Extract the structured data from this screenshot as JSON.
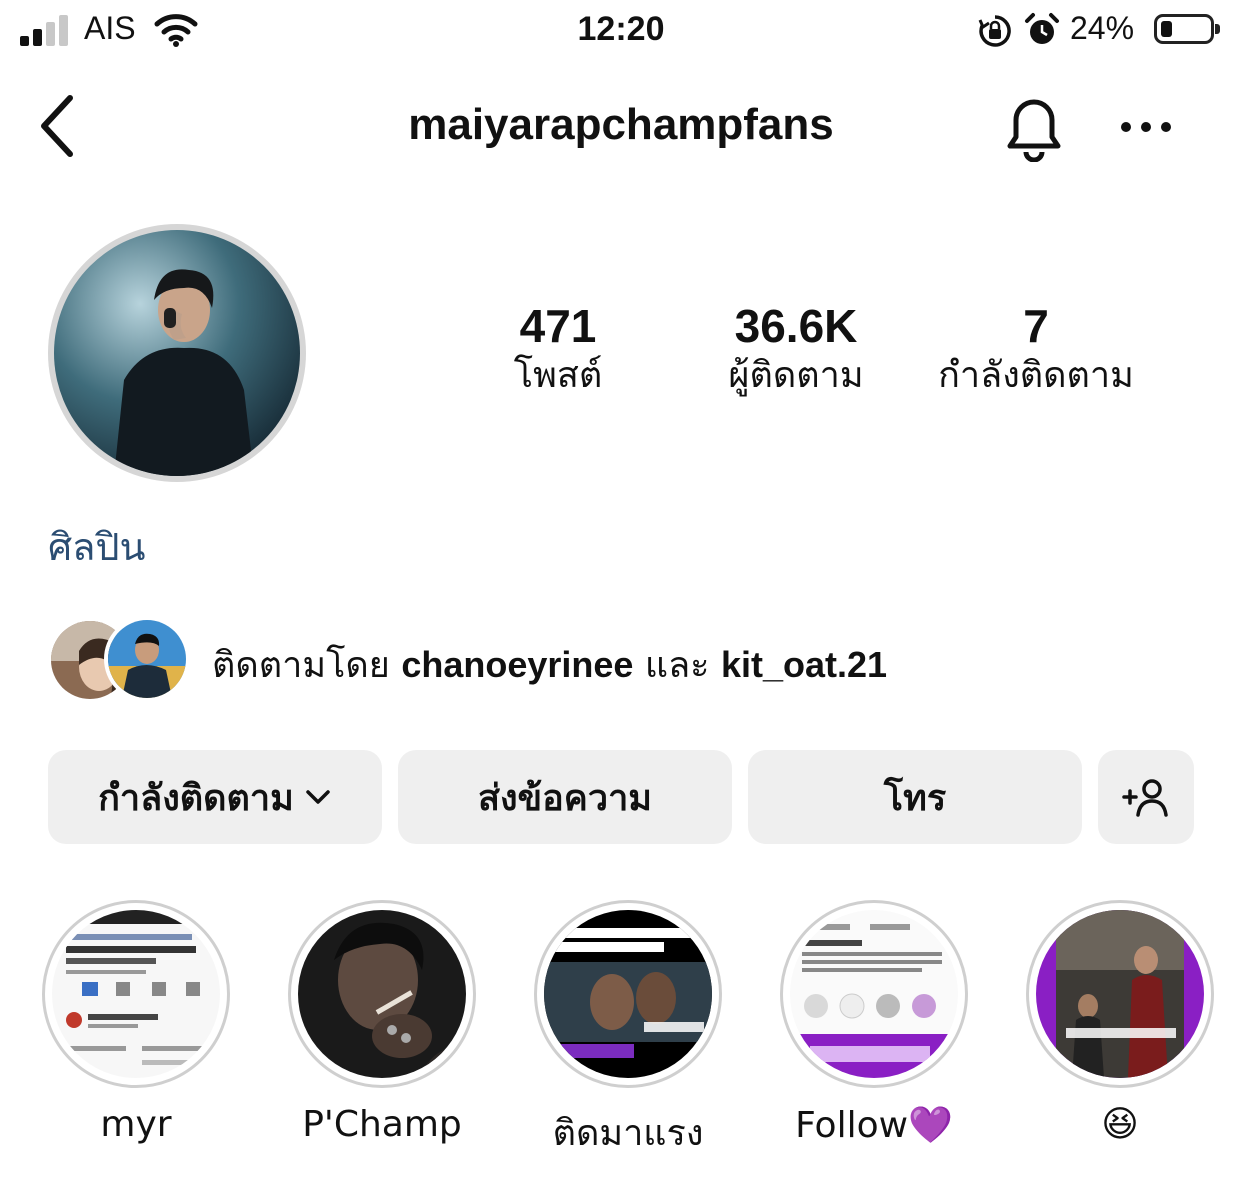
{
  "status_bar": {
    "carrier": "AIS",
    "time": "12:20",
    "battery_percent": "24%",
    "battery_level": 0.24,
    "signal_bars": 2,
    "icons": [
      "signal-icon",
      "wifi-icon",
      "rotation-lock-icon",
      "alarm-icon",
      "battery-icon"
    ]
  },
  "header": {
    "username": "maiyarapchampfans",
    "icons": [
      "back-chevron-icon",
      "bell-icon",
      "more-dots-icon"
    ]
  },
  "profile": {
    "stats": [
      {
        "value": "471",
        "label": "โพสต์"
      },
      {
        "value": "36.6K",
        "label": "ผู้ติดตาม"
      },
      {
        "value": "7",
        "label": "กำลังติดตาม"
      }
    ],
    "category": "ศิลปิน"
  },
  "followed_by": {
    "prefix": "ติดตามโดย",
    "user1": "chanoeyrinee",
    "conjunction": "และ",
    "user2": "kit_oat.21"
  },
  "actions": {
    "following": "กำลังติดตาม",
    "message": "ส่งข้อความ",
    "call": "โทร",
    "add_user_icon": "add-user-icon"
  },
  "highlights": [
    {
      "label": "myr"
    },
    {
      "label": "P'Champ"
    },
    {
      "label": "ติดมาแรง"
    },
    {
      "label": "Follow💜"
    },
    {
      "label": "😆"
    }
  ],
  "colors": {
    "category_text": "#2b4d72",
    "button_bg": "#efefef",
    "highlight_purple": "#8a1fc4"
  }
}
